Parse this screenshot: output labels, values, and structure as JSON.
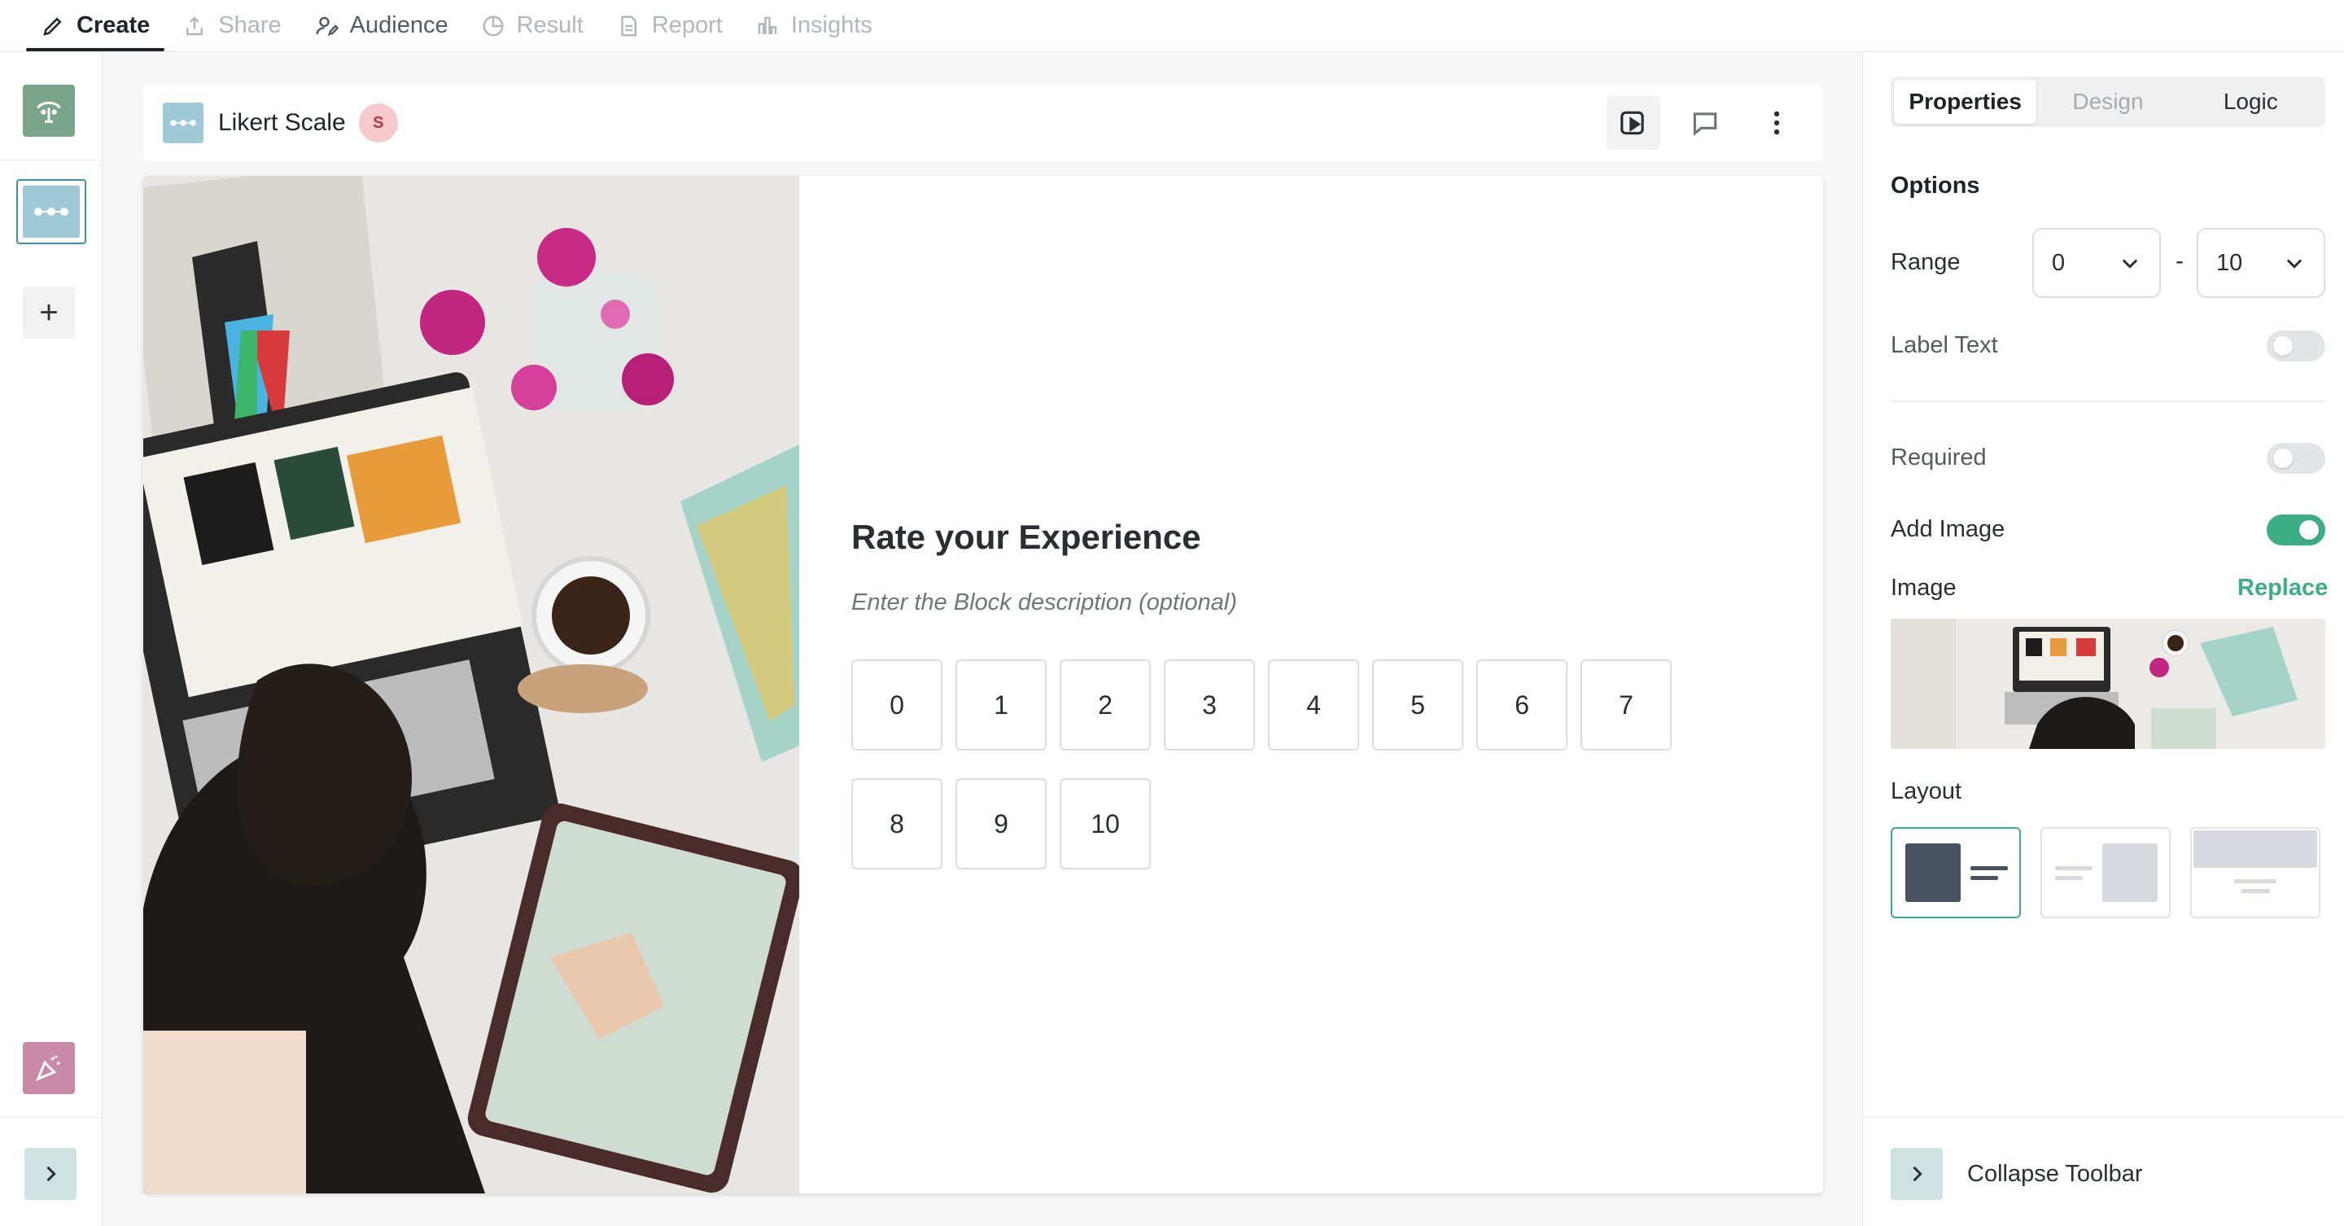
{
  "nav": {
    "tabs": [
      {
        "label": "Create",
        "icon": "pencil-icon",
        "state": "active"
      },
      {
        "label": "Share",
        "icon": "upload-icon",
        "state": "disabled"
      },
      {
        "label": "Audience",
        "icon": "user-edit-icon",
        "state": "enabled"
      },
      {
        "label": "Result",
        "icon": "pie-chart-icon",
        "state": "disabled"
      },
      {
        "label": "Report",
        "icon": "document-icon",
        "state": "disabled"
      },
      {
        "label": "Insights",
        "icon": "bar-chart-icon",
        "state": "disabled"
      }
    ]
  },
  "sidebar": {
    "add_label": "+",
    "items": [
      {
        "icon": "welcome-screen-icon",
        "color": "#7aa58a"
      },
      {
        "icon": "likert-scale-icon",
        "color": "#9fc9d6",
        "selected": true
      },
      {
        "icon": "end-screen-icon",
        "color": "#c98aa6"
      }
    ],
    "expand_icon": "chevron-right-icon"
  },
  "block": {
    "title": "Likert Scale",
    "badge": "S",
    "actions": [
      "preview-icon",
      "comment-icon",
      "more-vertical-icon"
    ]
  },
  "question": {
    "title": "Rate your Experience",
    "description_placeholder": "Enter the Block description (optional)",
    "options": [
      "0",
      "1",
      "2",
      "3",
      "4",
      "5",
      "6",
      "7",
      "8",
      "9",
      "10"
    ]
  },
  "panel": {
    "tabs": [
      "Properties",
      "Design",
      "Logic"
    ],
    "active_tab": "Properties",
    "options_title": "Options",
    "range_label": "Range",
    "range_min": "0",
    "range_sep": "-",
    "range_max": "10",
    "label_text_label": "Label Text",
    "label_text_on": false,
    "required_label": "Required",
    "required_on": false,
    "add_image_label": "Add Image",
    "add_image_on": true,
    "image_label": "Image",
    "replace_label": "Replace",
    "layout_label": "Layout",
    "layouts": [
      "image-left",
      "image-right",
      "image-top"
    ],
    "active_layout": "image-left",
    "collapse_label": "Collapse Toolbar"
  },
  "colors": {
    "accent": "#3cae83",
    "block_icon": "#9fc9d6",
    "badge_bg": "#f6c9cf"
  }
}
